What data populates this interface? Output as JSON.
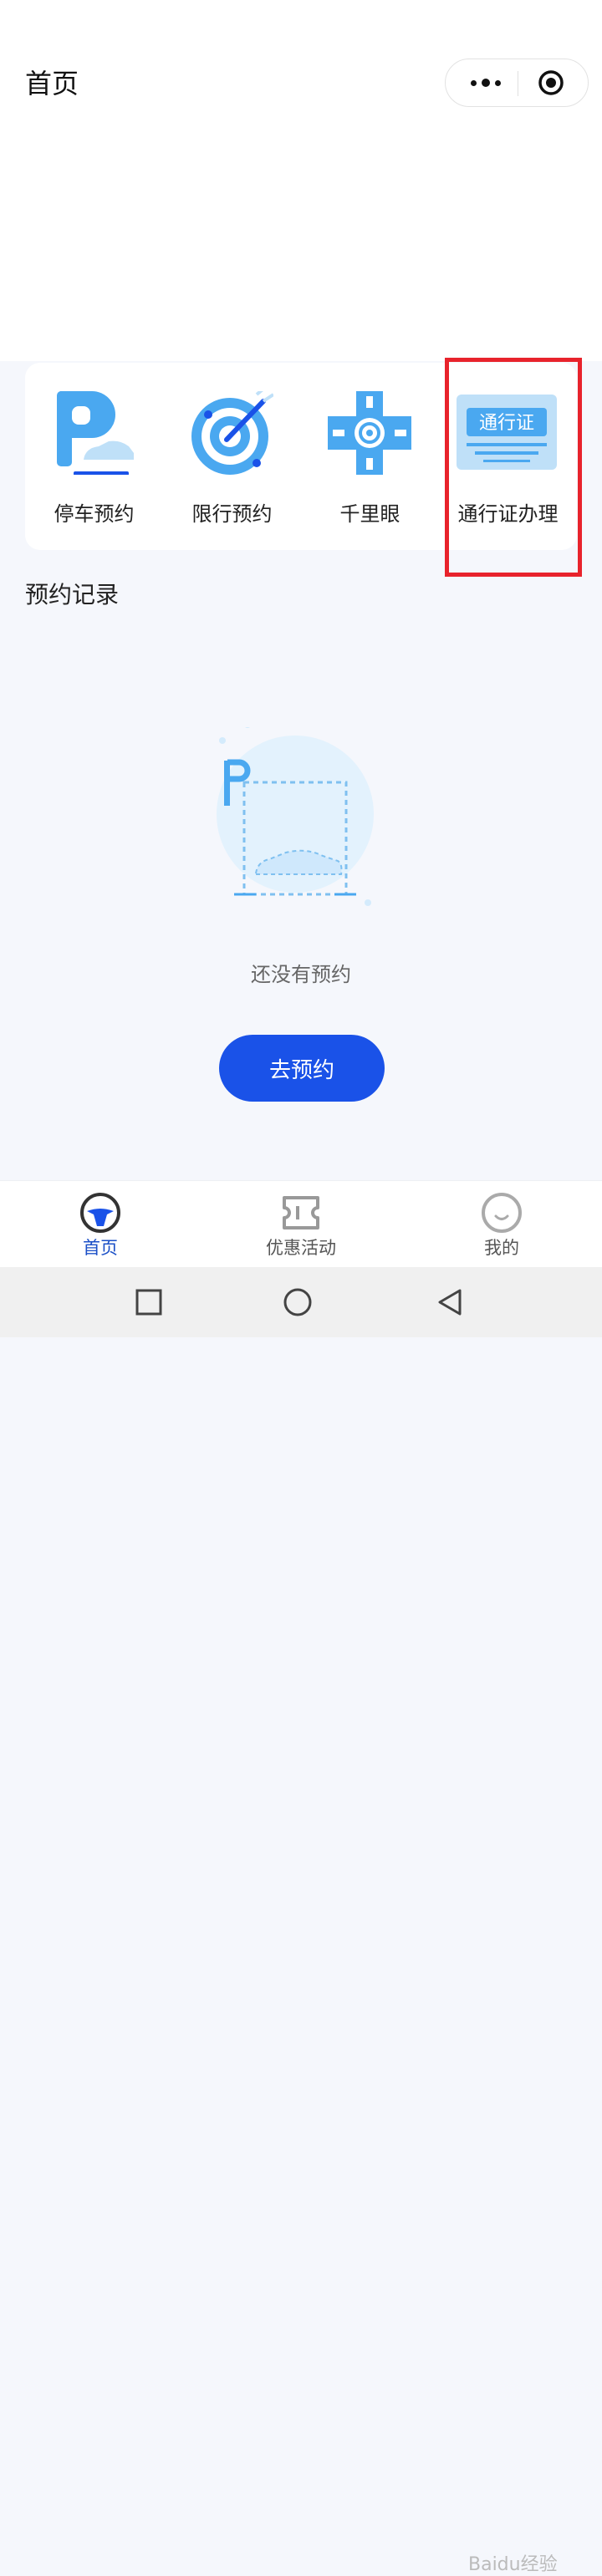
{
  "header": {
    "title": "首页",
    "more_icon": "more-dots-icon",
    "close_icon": "target-circle-icon"
  },
  "services": [
    {
      "label": "停车预约",
      "icon": "parking-icon"
    },
    {
      "label": "限行预约",
      "icon": "target-dart-icon"
    },
    {
      "label": "千里眼",
      "icon": "road-cross-camera-icon"
    },
    {
      "label": "通行证办理",
      "icon": "pass-card-icon",
      "icon_text": "通行证"
    }
  ],
  "records": {
    "title": "预约记录",
    "empty_text": "还没有预约",
    "empty_icon": "empty-parking-illustration",
    "cta_label": "去预约"
  },
  "tabbar": {
    "items": [
      {
        "label": "首页",
        "icon": "steering-wheel-icon",
        "active": true
      },
      {
        "label": "优惠活动",
        "icon": "ticket-icon",
        "active": false
      },
      {
        "label": "我的",
        "icon": "smile-face-icon",
        "active": false
      }
    ]
  },
  "watermark": "Baidu经验",
  "colors": {
    "accent": "#1a52e8",
    "icon_blue": "#4aa8f0",
    "highlight_box": "#e8232c",
    "page_bg": "#f5f7fc"
  }
}
